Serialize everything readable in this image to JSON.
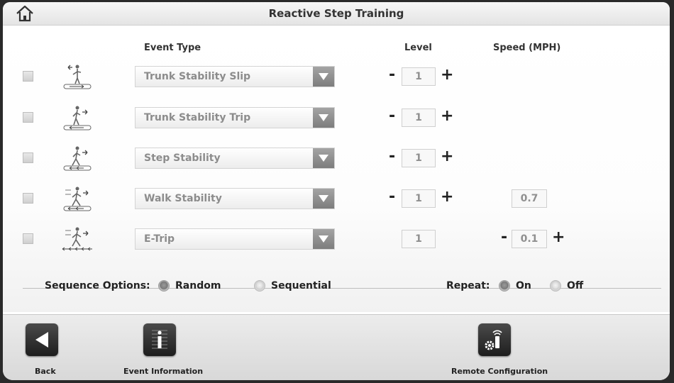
{
  "header": {
    "title": "Reactive Step Training"
  },
  "columns": {
    "event_type": "Event Type",
    "level": "Level",
    "speed": "Speed (MPH)"
  },
  "events": [
    {
      "event": "Trunk Stability Slip",
      "level": "1",
      "icon": "trunk-slip-icon"
    },
    {
      "event": "Trunk Stability Trip",
      "level": "1",
      "icon": "trunk-trip-icon"
    },
    {
      "event": "Step Stability",
      "level": "1",
      "icon": "step-stability-icon"
    },
    {
      "event": "Walk Stability",
      "level": "1",
      "speed": "0.7",
      "icon": "walk-stability-icon"
    },
    {
      "event": "E-Trip",
      "level": "1",
      "speed": "0.1",
      "icon": "e-trip-icon"
    }
  ],
  "controls": {
    "minus": "-",
    "plus": "+"
  },
  "sequence": {
    "label": "Sequence Options:",
    "random": "Random",
    "sequential": "Sequential",
    "selected": "Random"
  },
  "repeat": {
    "label": "Repeat:",
    "on": "On",
    "off": "Off",
    "selected": "On"
  },
  "footer": {
    "back": "Back",
    "event_info": "Event Information",
    "remote_config": "Remote Configuration"
  }
}
